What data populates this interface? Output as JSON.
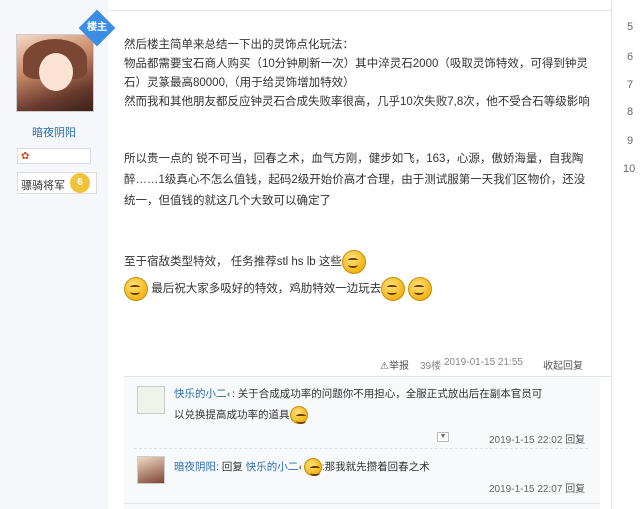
{
  "author": {
    "name": "暗夜阴阳",
    "badge": "楼主",
    "rank": "骠骑将军",
    "rank_level": "6"
  },
  "right_numbers": [
    "5",
    "6",
    "7",
    "8",
    "9",
    "10"
  ],
  "post": {
    "lines": [
      "然后楼主简单来总结一下出的灵饰点化玩法：",
      "物品都需要宝石商人购买（10分钟刷新一次）其中淬灵石2000（吸取灵饰特效，可得到钟灵",
      "石）灵篆最高80000,（用于给灵饰增加特效）",
      "然而我和其他朋友都反应钟灵石合成失败率很高，几乎10次失败7,8次，他不受合石等级影响",
      "所以贵一点的 锐不可当，回春之术，血气方刚，健步如飞，163，心源，傲娇海量，自我陶",
      "醉……1级真心不怎么值钱，起码2级开始价高才合理，由于测试服第一天我们区物价，还没",
      "统一，但值钱的就这几个大致可以确定了",
      "至于宿敌类型特效， 任务推荐stl hs lb 这些",
      "最后祝大家多吸好的特效，鸡肋特效一边玩去"
    ]
  },
  "post_actions": {
    "report": "举报",
    "floor": "39楼",
    "time": "2019-01-15 21:55",
    "reply": "收起回复"
  },
  "comments": [
    {
      "user": "快乐的小二",
      "text1": ": 关于合成成功率的问题你不用担心，全服正式放出后在副本官员可",
      "text2": "以兑换提高成功率的道具",
      "time": "2019-1-15 22:02",
      "reply": "回复"
    },
    {
      "user": "暗夜阴阳",
      "reply_word": ": 回复 ",
      "reply_to": "快乐的小二",
      "text": ":那我就先攒着回春之术",
      "time": "2019-1-15 22:07",
      "reply": "回复"
    }
  ]
}
